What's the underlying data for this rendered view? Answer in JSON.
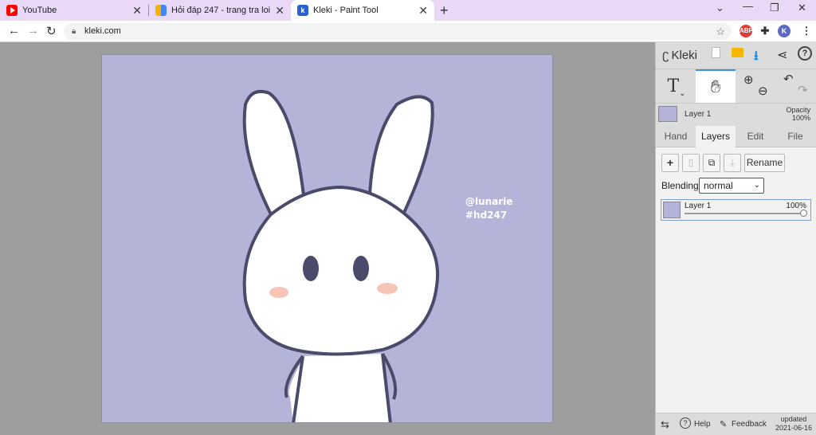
{
  "browser": {
    "tabs": [
      {
        "title": "YouTube",
        "icon": "youtube-icon",
        "color": "#ff0000"
      },
      {
        "title": "Hỏi đáp 247 - trang tra loi",
        "icon": "hoidap-icon",
        "color": "#f4b400"
      },
      {
        "title": "Kleki - Paint Tool",
        "icon": "kleki-icon",
        "color": "#2a62d6"
      }
    ],
    "url": "kleki.com",
    "profile_letter": "K",
    "abp_label": "ABP"
  },
  "canvas": {
    "background": "#b4b4d9",
    "watermark_line1": "@lunarie",
    "watermark_line2": "#hd247"
  },
  "panel": {
    "logo": "Kleki",
    "layer_name": "Layer 1",
    "opacity_label": "Opacity",
    "opacity_value": "100%",
    "tabs": [
      "Hand",
      "Layers",
      "Edit",
      "File"
    ],
    "active_tab": "Layers",
    "rename_label": "Rename",
    "blending_label": "Blending",
    "blending_value": "normal",
    "layers": [
      {
        "name": "Layer 1",
        "opacity": "100%",
        "opacity_fraction": 1.0
      }
    ],
    "bottom": {
      "help": "Help",
      "feedback": "Feedback",
      "updated_label": "updated",
      "updated_date": "2021-06-16"
    }
  }
}
